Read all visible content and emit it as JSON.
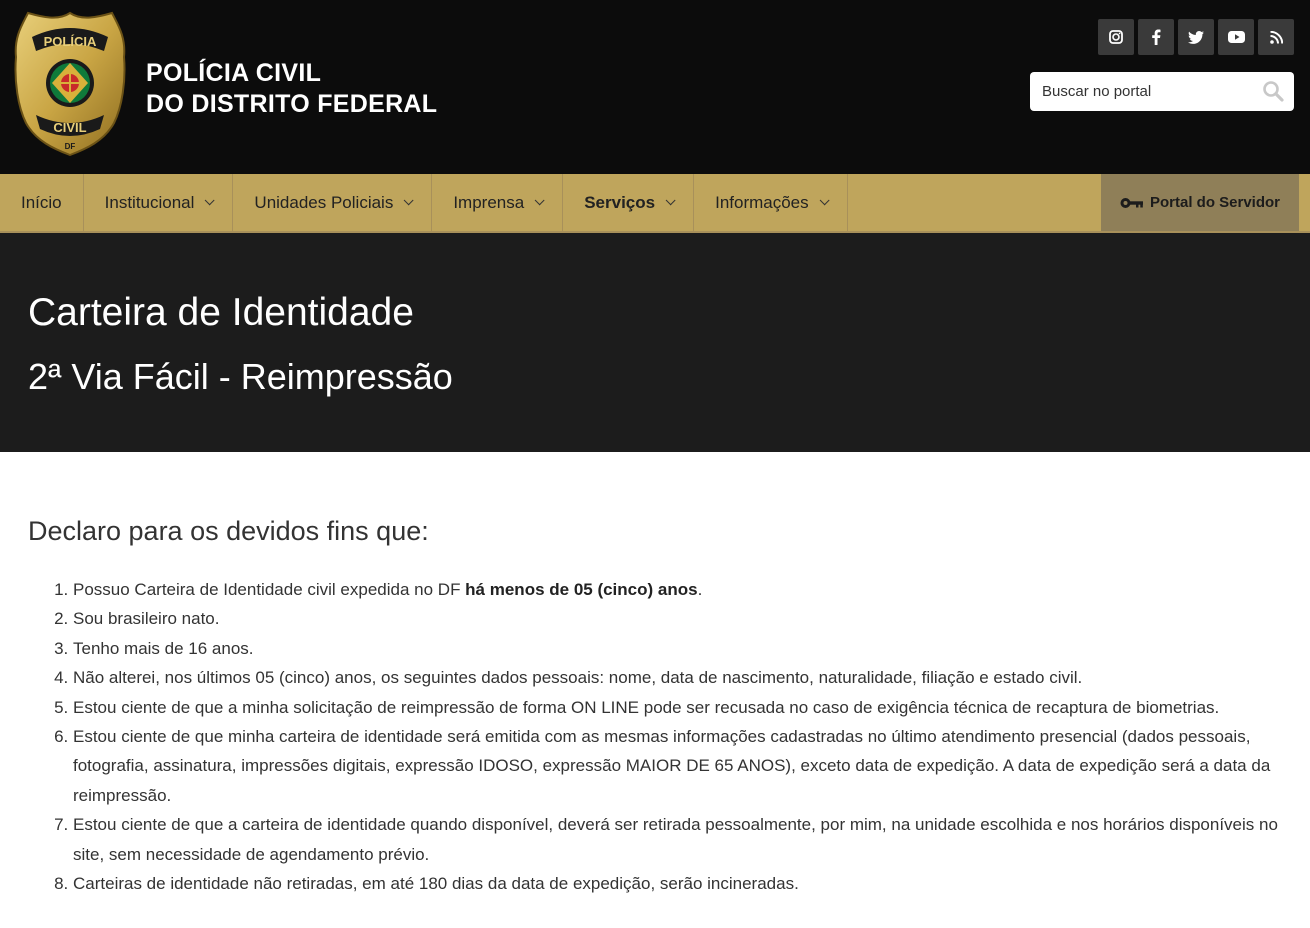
{
  "header": {
    "brand_line1": "POLÍCIA CIVIL",
    "brand_line2": "DO DISTRITO FEDERAL",
    "badge_top": "POLÍCIA",
    "badge_bottom": "CIVIL",
    "badge_df": "DF",
    "social": [
      {
        "icon": "instagram-icon"
      },
      {
        "icon": "facebook-icon"
      },
      {
        "icon": "twitter-icon"
      },
      {
        "icon": "youtube-icon"
      },
      {
        "icon": "rss-icon"
      }
    ],
    "search_placeholder": "Buscar no portal"
  },
  "nav": {
    "items": [
      {
        "label": "Início"
      },
      {
        "label": "Institucional"
      },
      {
        "label": "Unidades Policiais"
      },
      {
        "label": "Imprensa"
      },
      {
        "label": "Serviços"
      },
      {
        "label": "Informações"
      }
    ],
    "portal_label": "Portal do Servidor"
  },
  "hero": {
    "title": "Carteira de Identidade",
    "subtitle": "2ª Via Fácil - Reimpressão"
  },
  "content": {
    "heading": "Declaro para os devidos fins que:",
    "item1_text": "Possuo Carteira de Identidade civil expedida no DF ",
    "item1_bold": "há menos de 05 (cinco) anos",
    "item1_end": ".",
    "items": [
      "Sou brasileiro nato.",
      "Tenho mais de 16 anos.",
      "Não alterei, nos últimos 05 (cinco) anos, os seguintes dados pessoais: nome, data de nascimento, naturalidade, filiação e estado civil.",
      "Estou ciente de que a minha solicitação de reimpressão de forma ON LINE pode ser recusada no caso de exigência técnica de recaptura de biometrias.",
      "Estou ciente de que minha carteira de identidade será emitida com as mesmas informações cadastradas no último atendimento presencial (dados pessoais, fotografia, assinatura, impressões digitais, expressão IDOSO, expressão MAIOR DE 65 ANOS), exceto data de expedição. A data de expedição será a data da reimpressão.",
      "Estou ciente de que a carteira de identidade quando disponível, deverá ser retirada pessoalmente, por mim, na unidade escolhida e nos horários disponíveis no site, sem necessidade de agendamento prévio.",
      "Carteiras de identidade não retiradas, em até 180 dias da data de expedição, serão incineradas."
    ]
  },
  "colors": {
    "header_bg": "#0c0c0c",
    "nav_bg": "#bfa55c",
    "portal_bg": "#8f7f58",
    "hero_bg": "#1c1c1c"
  }
}
